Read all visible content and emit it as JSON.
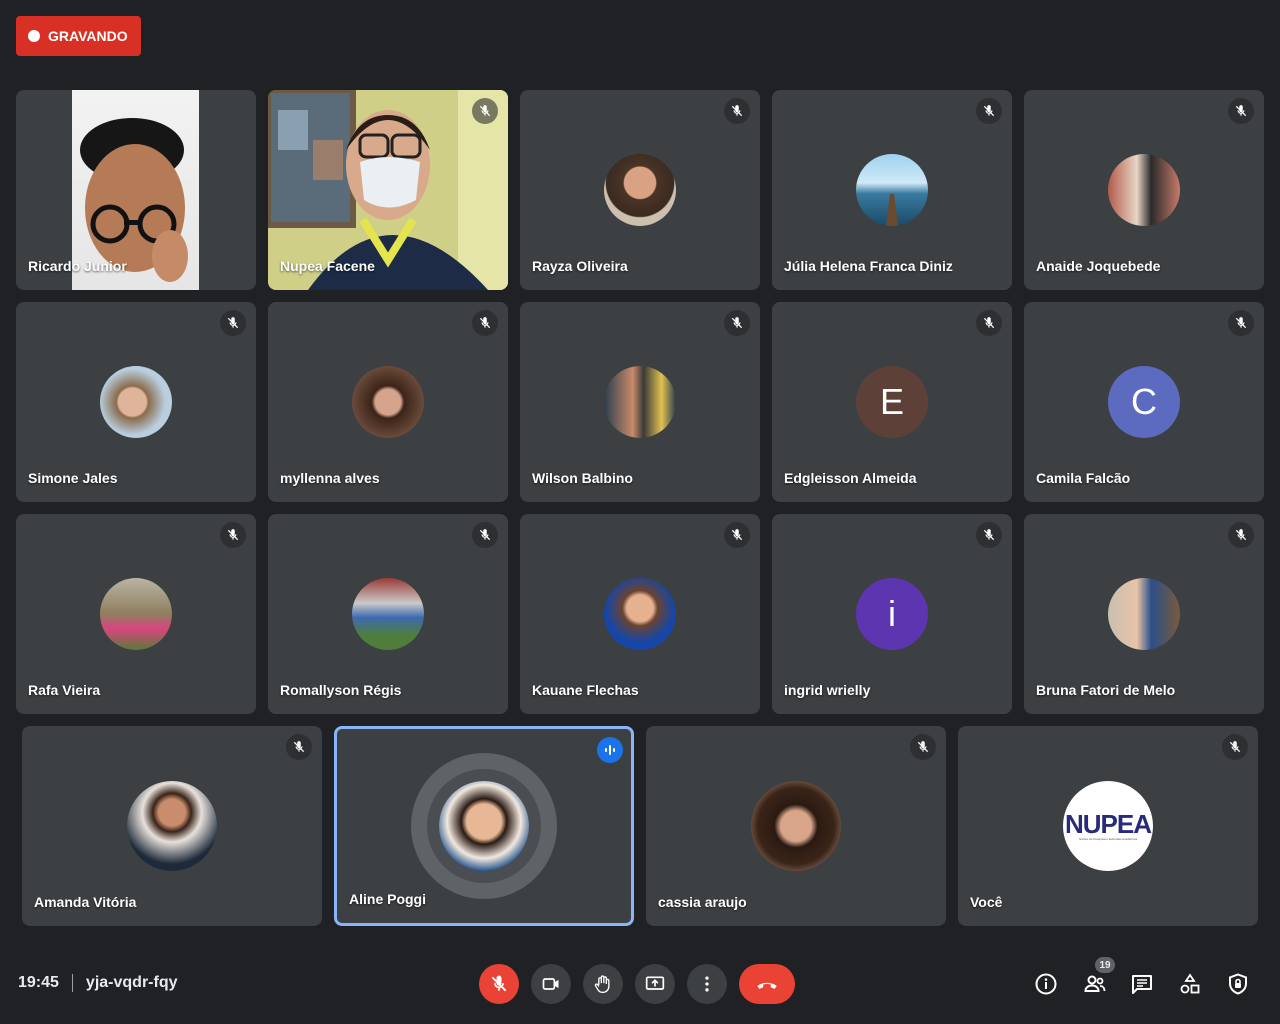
{
  "recording": {
    "label": "GRAVANDO"
  },
  "meeting": {
    "time": "19:45",
    "code": "yja-vqdr-fqy"
  },
  "participants_count": "19",
  "tiles": [
    {
      "name": "Ricardo Junior",
      "kind": "video",
      "muted": false
    },
    {
      "name": "Nupea Facene",
      "kind": "video",
      "muted": true
    },
    {
      "name": "Rayza Oliveira",
      "kind": "photo",
      "muted": true
    },
    {
      "name": "Júlia Helena Franca Diniz",
      "kind": "photo",
      "muted": true
    },
    {
      "name": "Anaide Joquebede",
      "kind": "photo",
      "muted": true
    },
    {
      "name": "Simone Jales",
      "kind": "photo",
      "muted": true
    },
    {
      "name": "myllenna alves",
      "kind": "photo",
      "muted": true
    },
    {
      "name": "Wilson Balbino",
      "kind": "photo",
      "muted": true
    },
    {
      "name": "Edgleisson Almeida",
      "kind": "letter",
      "letter": "E",
      "color": "#5d4037",
      "muted": true
    },
    {
      "name": "Camila Falcão",
      "kind": "letter",
      "letter": "C",
      "color": "#5c6bc0",
      "muted": true
    },
    {
      "name": "Rafa Vieira",
      "kind": "photo",
      "muted": true
    },
    {
      "name": "Romallyson Régis",
      "kind": "photo",
      "muted": true
    },
    {
      "name": "Kauane Flechas",
      "kind": "photo",
      "muted": true
    },
    {
      "name": "ingrid wrielly",
      "kind": "letter",
      "letter": "i",
      "color": "#5e35b1",
      "muted": true
    },
    {
      "name": "Bruna Fatori de Melo",
      "kind": "photo",
      "muted": true
    },
    {
      "name": "Amanda Vitória",
      "kind": "photo",
      "muted": true
    },
    {
      "name": "Aline Poggi",
      "kind": "photo",
      "speaking": true,
      "muted": false
    },
    {
      "name": "cassia araujo",
      "kind": "photo",
      "muted": true
    },
    {
      "name": "Você",
      "kind": "logo",
      "logo_text": "NUPEA",
      "logo_subtext": "Núcleo de Pesquisa e Extensão Acadêmica",
      "muted": true
    }
  ],
  "colors": {
    "background": "#202124",
    "tile": "#3c4043",
    "recording": "#d93025",
    "hangup": "#ea4335",
    "speaking_border": "#8ab4f8"
  },
  "controls": [
    "mic-off-icon",
    "camera-icon",
    "raise-hand-icon",
    "present-screen-icon",
    "more-options-icon",
    "hang-up-icon"
  ],
  "right_icons": [
    "info-icon",
    "people-icon",
    "chat-icon",
    "activities-icon",
    "host-controls-icon"
  ]
}
